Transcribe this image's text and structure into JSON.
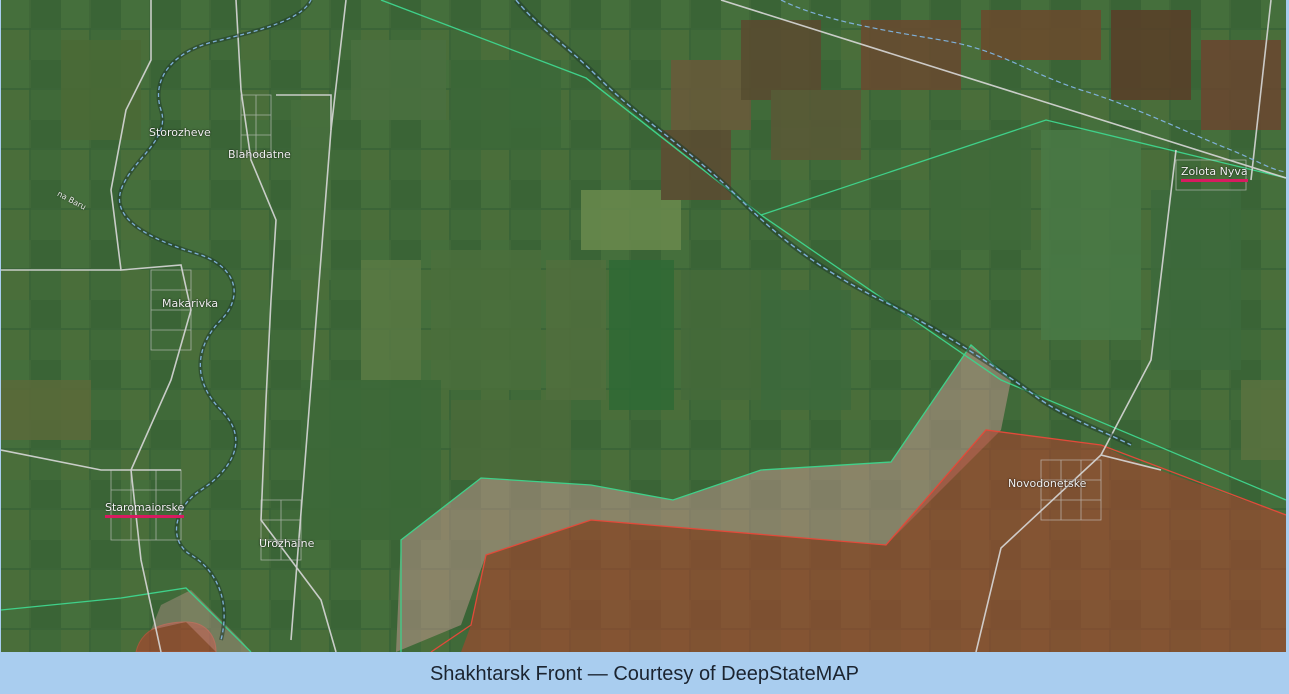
{
  "map": {
    "places": [
      {
        "id": "storozheve",
        "name": "Storozheve",
        "marked": false
      },
      {
        "id": "blahodatne",
        "name": "Blahodatne",
        "marked": false
      },
      {
        "id": "makarivka",
        "name": "Makarivka",
        "marked": false
      },
      {
        "id": "staromaiorske",
        "name": "Staromaiorske",
        "marked": true
      },
      {
        "id": "urozhaine",
        "name": "Urozhaine",
        "marked": false
      },
      {
        "id": "zolota-nyva",
        "name": "Zolota Nyva",
        "marked": true
      },
      {
        "id": "novodonetske",
        "name": "Novodonetske",
        "marked": false
      }
    ],
    "river_label": "na Baru",
    "colors": {
      "controlled_zone_fill": "#c98f8f",
      "occupied_zone_fill": "#c0392b",
      "contested_zone_fill": "#d9a0a0",
      "zone_border_green": "#3fd18a",
      "zone_border_red": "#e24a3a",
      "settlement_marker": "#d81b60",
      "river": "#7fb0d8",
      "roads": "#d8d8d8"
    }
  },
  "caption": "Shakhtarsk Front — Courtesy of DeepStateMAP"
}
